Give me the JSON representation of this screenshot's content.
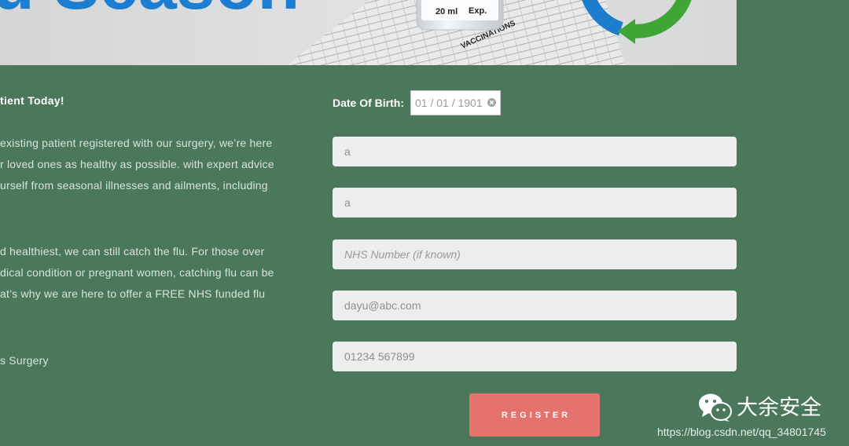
{
  "banner": {
    "heading": "u Season",
    "vial_volume": "20 ml",
    "vial_expiry": "Exp.",
    "sheet_title": "VACCINATIONS"
  },
  "intro": {
    "heading": "tient Today!",
    "paragraph1": [
      "existing patient registered with our surgery, we’re here",
      "r loved ones as healthy as possible. with expert advice",
      "urself from seasonal illnesses and ailments, including"
    ],
    "paragraph2": [
      "d healthiest, we can still catch the flu. For those over",
      "dical condition or pregnant women, catching flu can be",
      "at’s why we are here to offer a FREE NHS funded flu"
    ],
    "signoff": "s Surgery"
  },
  "form": {
    "dob": {
      "label": "Date Of Birth:",
      "value": "01 / 01 / 1901"
    },
    "first_name": {
      "value": "a"
    },
    "last_name": {
      "value": "a"
    },
    "nhs_number": {
      "value": "",
      "placeholder": "NHS Number (if known)"
    },
    "email": {
      "value": "dayu@abc.com"
    },
    "phone": {
      "value": "01234 567899"
    },
    "register_label": "REGISTER"
  },
  "watermark": {
    "brand": "大余安全",
    "url": "https://blog.csdn.net/qq_34801745"
  },
  "icons": {
    "date_clear": "clear-icon",
    "watermark": "wechat-icon",
    "banner_logo": "circular-arrows-logo"
  },
  "colors": {
    "background": "#4b785a",
    "banner_text": "#1c7ed0",
    "logo_blue": "#1e7ccc",
    "logo_green": "#3fa535",
    "field_background": "#ededed",
    "register_button": "#e6726e"
  }
}
